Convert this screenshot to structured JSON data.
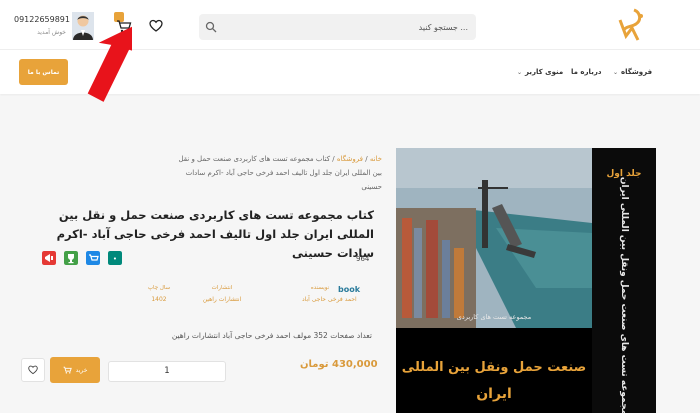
{
  "header": {
    "search_placeholder": "... جستجو کنید",
    "phone": "09122659891",
    "user_label": "خوش آمدید",
    "logo_icon": "brand-logo"
  },
  "nav": {
    "items": [
      {
        "label": "فروشگاه",
        "has_dropdown": true
      },
      {
        "label": "درباره ما",
        "has_dropdown": false
      },
      {
        "label": "منوی کاربر",
        "has_dropdown": true
      }
    ],
    "contact_label": "تماس با ما"
  },
  "product": {
    "image_top_label": "جلد اول",
    "image_subtitle": "مجموعه تست های کاربردی",
    "image_title_line1": "صنعت حمل ونقل بین المللی",
    "image_title_line2": "ایران",
    "image_spine": "مجموعه تست های صنعت حمل ونقل بین المللی ایران",
    "breadcrumb": {
      "home": "خانه",
      "shop": "فروشگاه",
      "sep": "/",
      "current": "کتاب مجموعه تست های کاربردی صنعت حمل و نقل بین المللی ایران جلد اول تالیف احمد فرخی حاجی آباد -اکرم سادات حسینی"
    },
    "title": "کتاب مجموعه تست های کاربردی صنعت حمل و نقل بین المللی ایران جلد اول تالیف احمد فرخی حاجی آباد -اکرم سادات حسینی",
    "view_count": "964",
    "book_logo_alt": "book",
    "attributes": [
      {
        "label": "نویسنده",
        "value": "احمد فرخی حاجی آباد"
      },
      {
        "label": "انتشارات",
        "value": "انتشارات راهین"
      },
      {
        "label": "سال چاپ",
        "value": "1402"
      }
    ],
    "description": "تعداد صفحات 352 مولف احمد فرخی حاجی آباد انتشارات راهین",
    "price": "430,000 تومان",
    "quantity": "1",
    "buy_label": "خرید"
  },
  "colors": {
    "accent": "#e8a33a",
    "red_arrow": "#e8131b"
  },
  "share_icons": [
    "share-telegram-icon",
    "share-twitter-icon",
    "share-whatsapp-icon",
    "share-more-icon"
  ]
}
